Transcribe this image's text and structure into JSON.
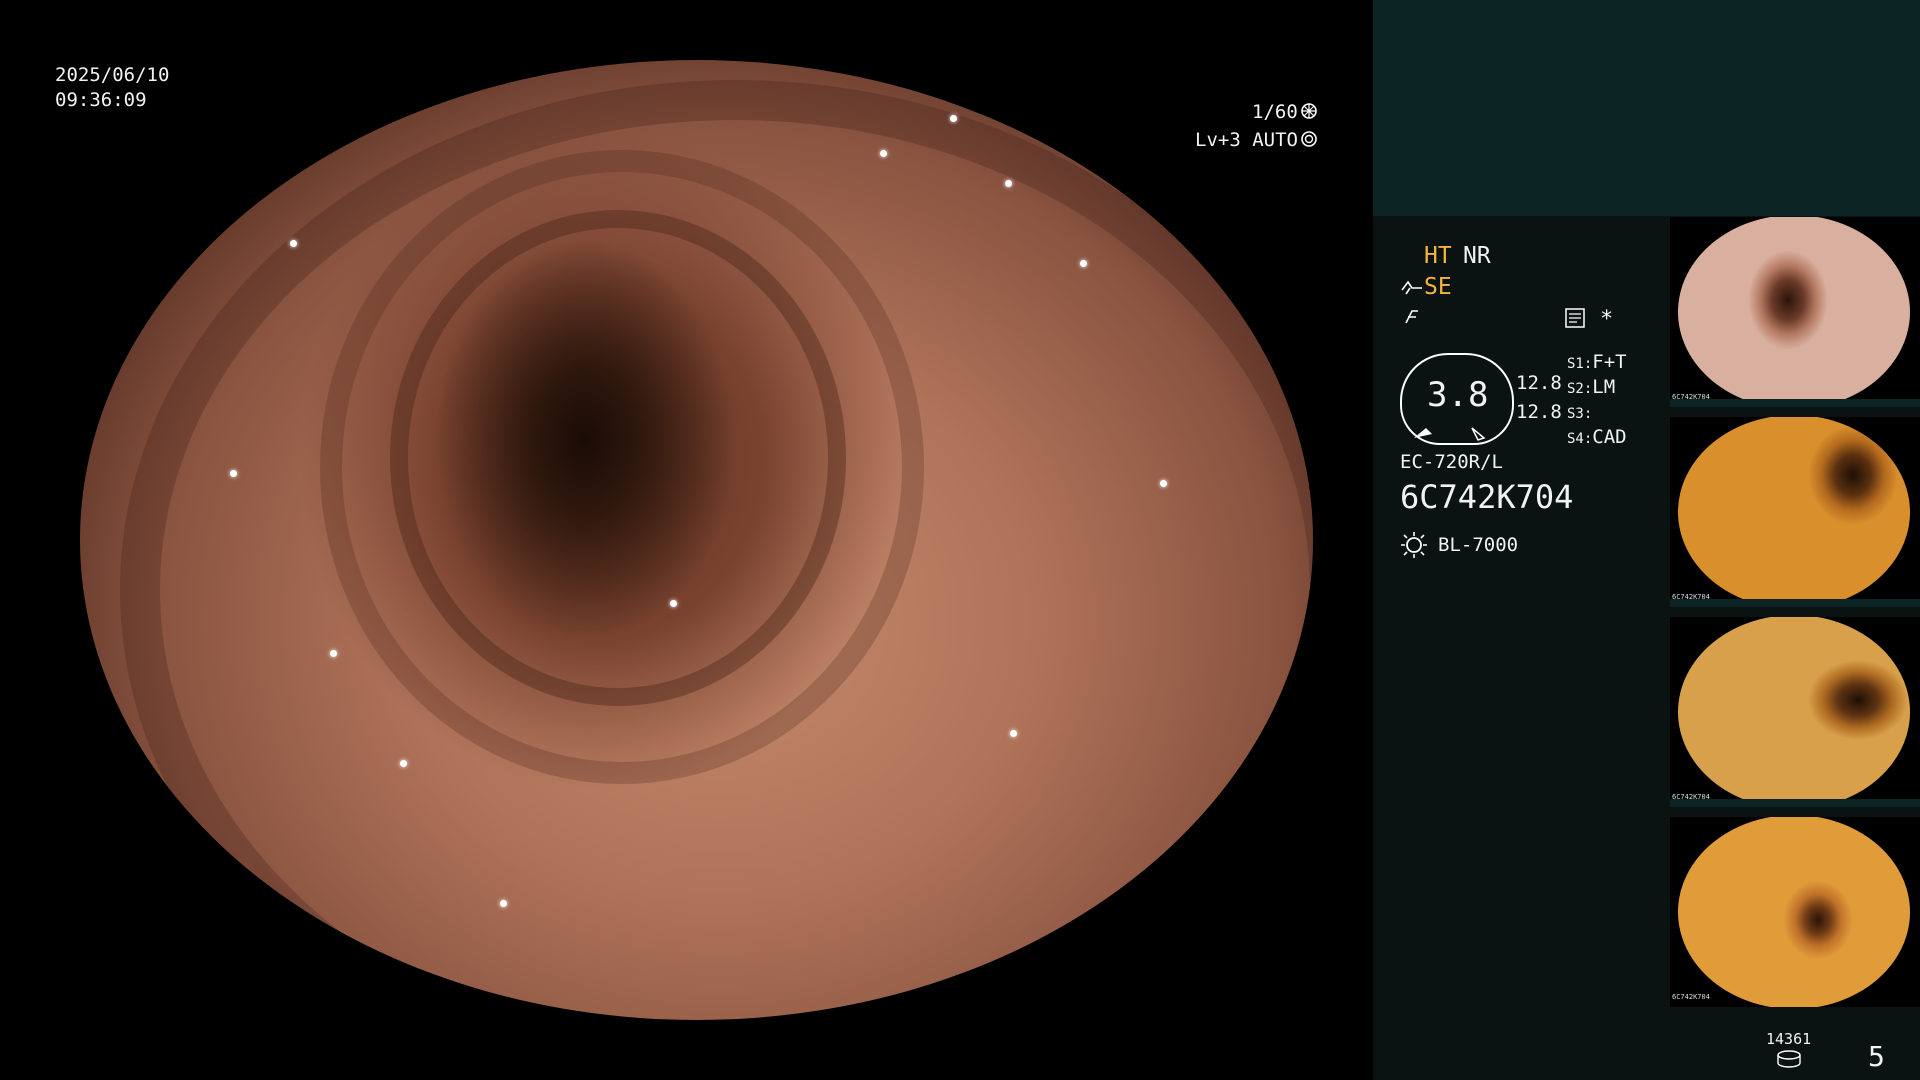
{
  "main": {
    "date": "2025/06/10",
    "time": "09:36:09",
    "shutter": "1/60",
    "level": "Lv+3 AUTO"
  },
  "panel": {
    "mode_ht": "HT",
    "mode_nr": "NR",
    "mode_se": "SE",
    "asterisk": "*",
    "cad_value": "3.8",
    "value_a": "12.8",
    "value_b": "12.8",
    "switches": [
      {
        "key": "S1:",
        "value": "F+T"
      },
      {
        "key": "S2:",
        "value": "LM"
      },
      {
        "key": "S3:",
        "value": ""
      },
      {
        "key": "S4:",
        "value": "CAD"
      }
    ],
    "scope_model": "EC-720R/L",
    "serial": "6C742K704",
    "light_source": "BL-7000",
    "storage_count": "14361",
    "image_count": "5"
  },
  "thumbnails": [
    {
      "label": "6C742K704"
    },
    {
      "label": "6C742K704"
    },
    {
      "label": "6C742K704"
    },
    {
      "label": "6C742K704"
    }
  ],
  "colors": {
    "panel_bg": "#0a1212",
    "panel_top": "#0d2425",
    "mode_highlight": "#f5b43a"
  },
  "icons": [
    "shutter-icon",
    "auto-iris-icon",
    "scope-angle-icon",
    "freeze-icon",
    "memory-card-icon",
    "light-source-icon",
    "storage-icon"
  ]
}
